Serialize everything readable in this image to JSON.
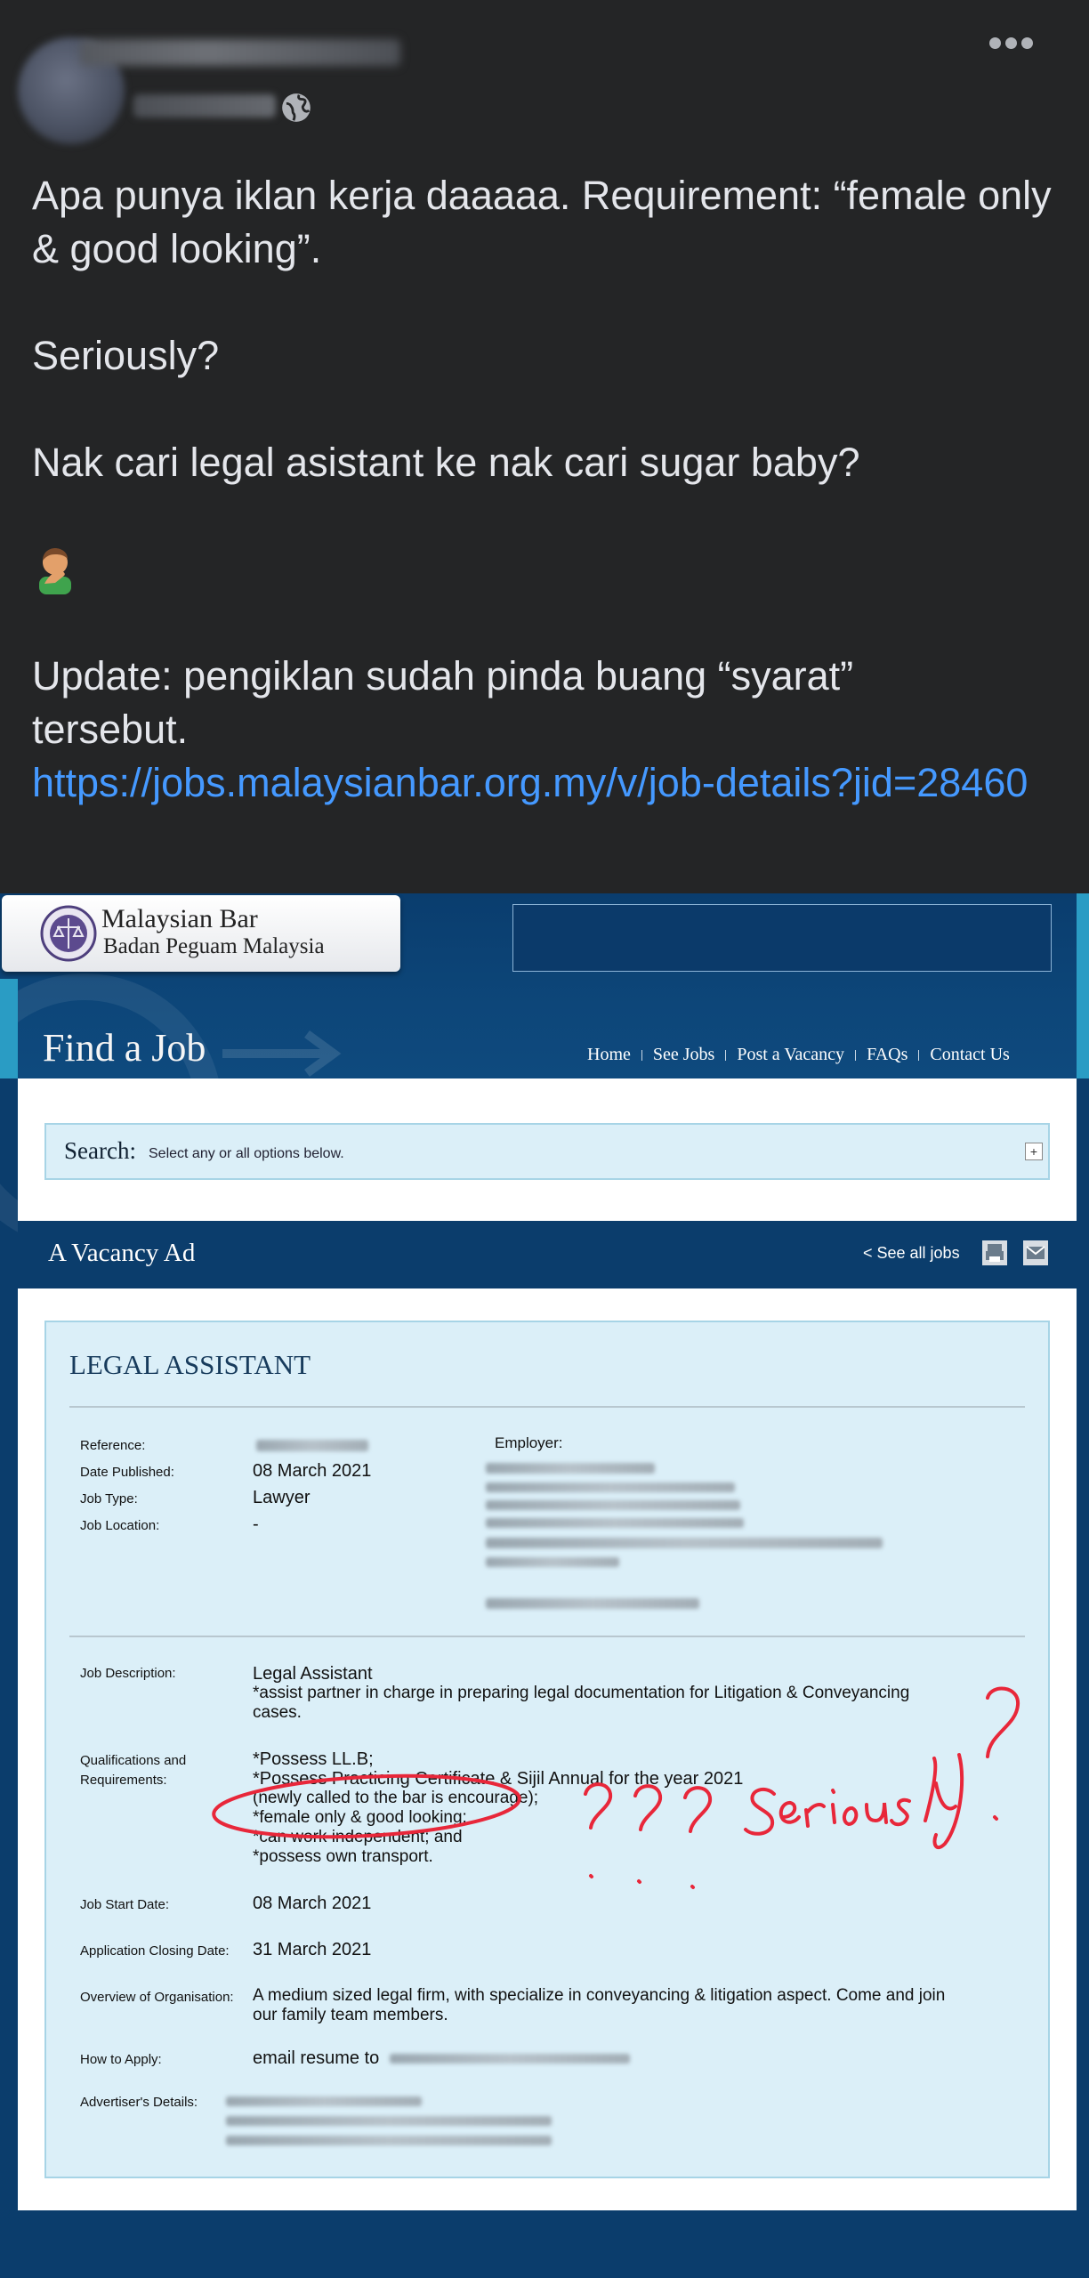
{
  "post": {
    "more_icon": "more-horizontal-icon",
    "privacy_icon": "globe-icon",
    "line1": "Apa punya iklan kerja daaaaa. Requirement: “female only & good looking”.",
    "line2": "Seriously?",
    "line3": "Nak cari legal asistant ke nak cari sugar baby?",
    "emoji": "facepalm-emoji",
    "update_line1": "Update: pengiklan sudah pinda buang “syarat”",
    "update_line2": "tersebut.",
    "link": "https://jobs.malaysianbar.org.my/v/job-details?jid=28460"
  },
  "site": {
    "logo_title": "Malaysian Bar",
    "logo_subtitle": "Badan Peguam Malaysia",
    "page_heading": "Find a Job",
    "nav": [
      "Home",
      "See Jobs",
      "Post a Vacancy",
      "FAQs",
      "Contact Us"
    ],
    "search_label": "Search:",
    "search_hint": "Select any or all options below.",
    "expand_label": "+",
    "vacancy_heading": "A Vacancy Ad",
    "see_all": "< See all jobs"
  },
  "job": {
    "title": "LEGAL ASSISTANT",
    "labels": {
      "reference": "Reference:",
      "date_published": "Date Published:",
      "job_type": "Job Type:",
      "job_location": "Job Location:",
      "employer": "Employer:",
      "description": "Job Description:",
      "qualifications_1": "Qualifications and",
      "qualifications_2": "Requirements:",
      "start_date": "Job Start Date:",
      "closing_date": "Application Closing Date:",
      "overview": "Overview of Organisation:",
      "how_to_apply": "How to Apply:",
      "advertiser": "Advertiser's Details:"
    },
    "date_published": "08 March 2021",
    "job_type": "Lawyer",
    "job_location": "-",
    "description_1": "Legal Assistant",
    "description_2": "*assist partner in charge in preparing legal documentation for Litigation & Conveyancing",
    "description_3": "cases.",
    "requirements": [
      "*Possess LL.B;",
      "*Possess Practicing Certificate & Sijil Annual for the year 2021",
      "(newly called to the bar is encourage);",
      "*female only & good looking;",
      "*can work independent; and",
      "*possess own transport."
    ],
    "start_date": "08 March 2021",
    "closing_date": "31 March 2021",
    "overview_1": "A medium sized legal firm, with specialize in conveyancing & litigation aspect. Come and join",
    "overview_2": "our family team members.",
    "how_to_apply": "email resume to"
  },
  "annotation": {
    "handwriting": "??? Seriously?",
    "color": "#e8273a"
  }
}
